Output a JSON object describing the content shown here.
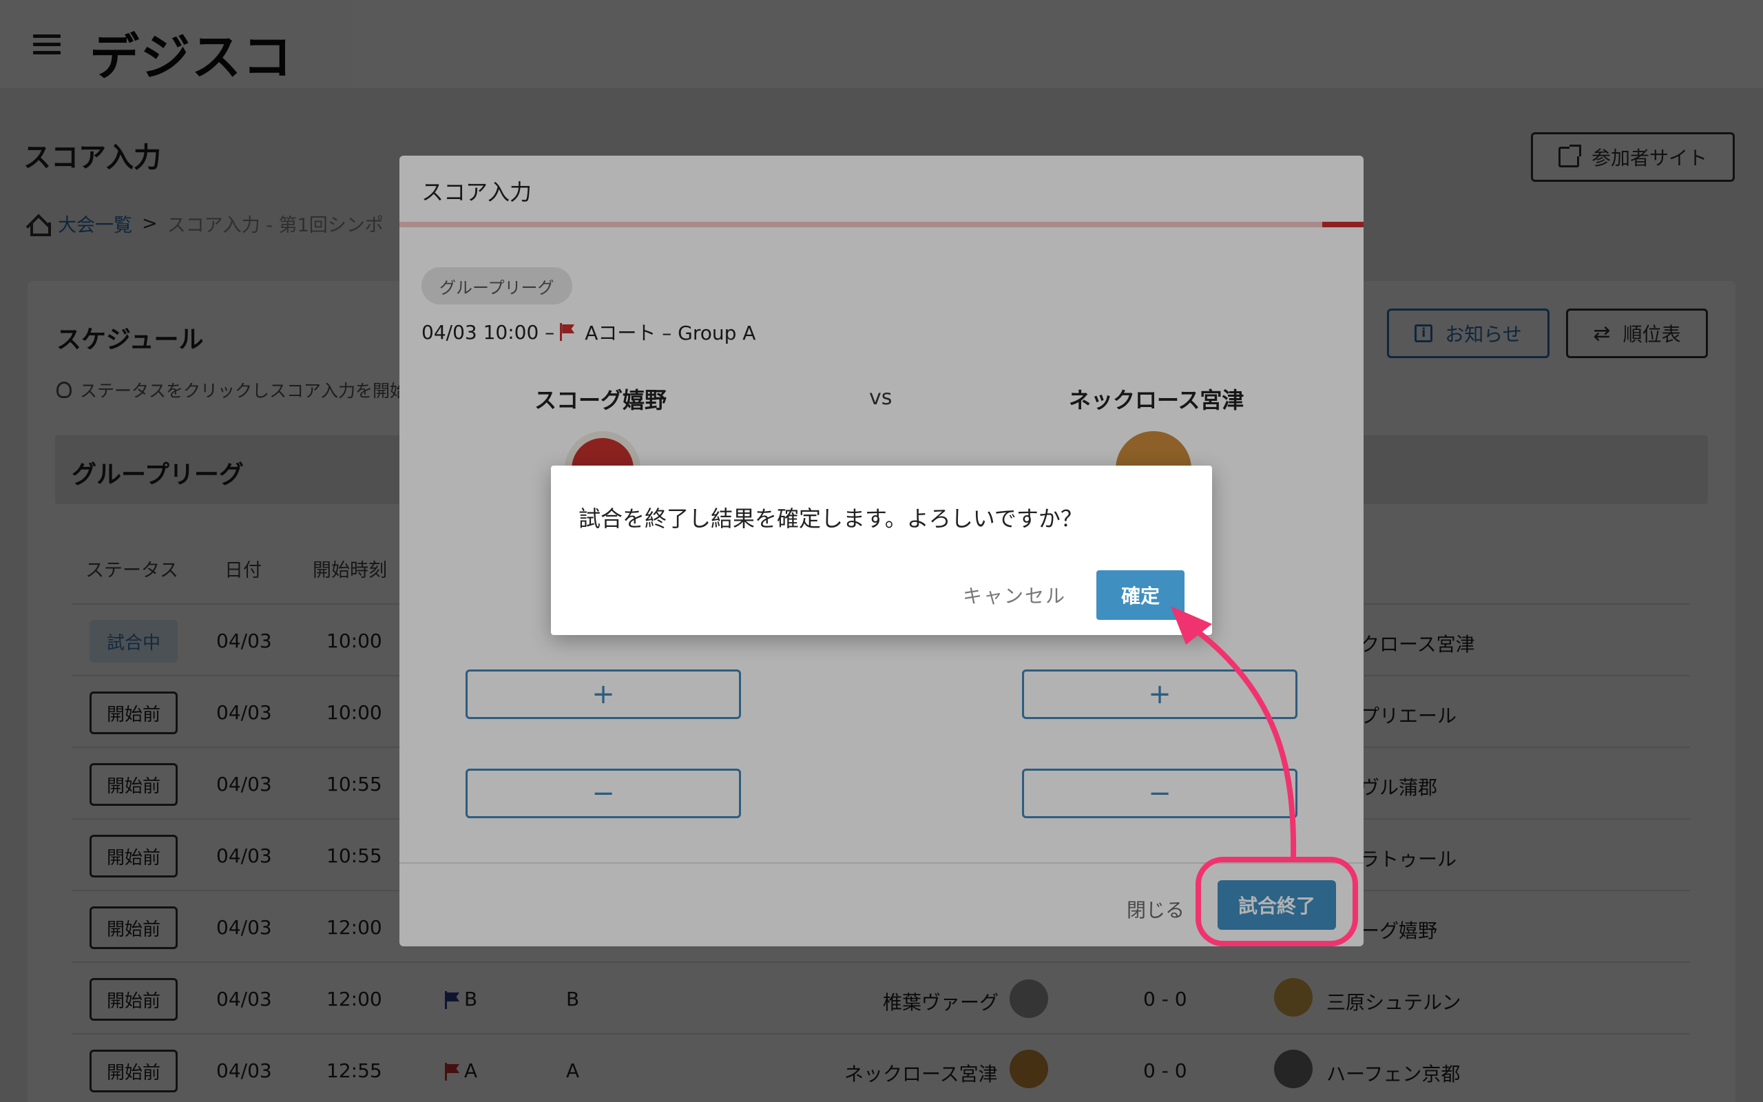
{
  "app": {
    "logo_text": "デジスコ"
  },
  "page": {
    "title": "スコア入力",
    "participant_site_label": "参加者サイト",
    "breadcrumb": {
      "home": "大会一覧",
      "separator": ">",
      "current": "スコア入力 - 第1回シンポ"
    }
  },
  "schedule": {
    "title": "スケジュール",
    "hint": "ステータスをクリックしスコア入力を開始",
    "buttons": {
      "notice": "お知らせ",
      "standings": "順位表"
    },
    "group_title": "グループリーグ",
    "headers": {
      "status": "ステータス",
      "date": "日付",
      "start": "開始時刻"
    },
    "rows": [
      {
        "status": "試合中",
        "date": "04/03",
        "time": "10:00",
        "away": "クロース宮津"
      },
      {
        "status": "開始前",
        "date": "04/03",
        "time": "10:00",
        "away": "プリエール"
      },
      {
        "status": "開始前",
        "date": "04/03",
        "time": "10:55",
        "away": "ヴル蒲郡"
      },
      {
        "status": "開始前",
        "date": "04/03",
        "time": "10:55",
        "away": "ラトゥール"
      },
      {
        "status": "開始前",
        "date": "04/03",
        "time": "12:00",
        "away": "ーグ嬉野"
      },
      {
        "status": "開始前",
        "date": "04/03",
        "time": "12:00",
        "court": "B",
        "group": "B",
        "home": "椎葉ヴァーグ",
        "score": "0 - 0",
        "away": "三原シュテルン"
      },
      {
        "status": "開始前",
        "date": "04/03",
        "time": "12:55",
        "court": "A",
        "group": "A",
        "home": "ネックロース宮津",
        "score": "0 - 0",
        "away": "ハーフェン京都"
      }
    ]
  },
  "score_modal": {
    "title": "スコア入力",
    "league_chip": "グループリーグ",
    "match_datetime": "04/03 10:00 –",
    "match_court": "Aコート – Group A",
    "home_team": "スコーグ嬉野",
    "vs": "vs",
    "away_team": "ネックロース宮津",
    "plus": "+",
    "minus": "−",
    "close_label": "閉じる",
    "end_label": "試合終了"
  },
  "confirm_dialog": {
    "message": "試合を終了し結果を確定します。よろしいですか？",
    "cancel_label": "キャンセル",
    "ok_label": "確定"
  },
  "colors": {
    "accent": "#3f8fc0",
    "annotation": "#f0336e",
    "flag_red": "#c8322f",
    "flag_blue": "#2c3f8f"
  }
}
